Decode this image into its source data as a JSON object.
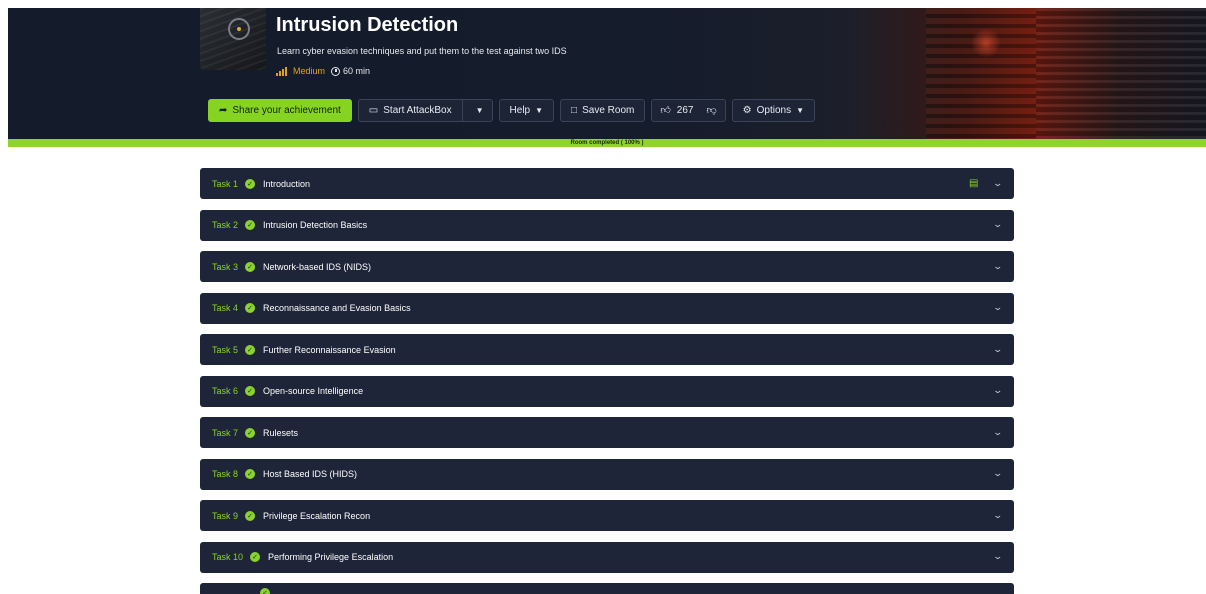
{
  "room": {
    "title": "Intrusion Detection",
    "description": "Learn cyber evasion techniques and put them to the test against two IDS",
    "difficulty": "Medium",
    "duration": "60 min",
    "difficulty_color": "#e0a21a"
  },
  "toolbar": {
    "share_label": "Share your achievement",
    "attackbox_label": "Start AttackBox",
    "help_label": "Help",
    "save_label": "Save Room",
    "likes": "267",
    "options_label": "Options"
  },
  "progress": {
    "label": "Room completed ( 100% )",
    "percent": 100,
    "color": "#8fd42b"
  },
  "tasks": [
    {
      "number": "Task 1",
      "title": "Introduction"
    },
    {
      "number": "Task 2",
      "title": "Intrusion Detection Basics"
    },
    {
      "number": "Task 3",
      "title": "Network-based IDS (NIDS)"
    },
    {
      "number": "Task 4",
      "title": "Reconnaissance and Evasion Basics"
    },
    {
      "number": "Task 5",
      "title": "Further Reconnaissance Evasion"
    },
    {
      "number": "Task 6",
      "title": "Open-source Intelligence"
    },
    {
      "number": "Task 7",
      "title": "Rulesets"
    },
    {
      "number": "Task 8",
      "title": "Host Based IDS (HIDS)"
    },
    {
      "number": "Task 9",
      "title": "Privilege Escalation Recon"
    },
    {
      "number": "Task 10",
      "title": "Performing Privilege Escalation"
    }
  ],
  "icons": {
    "share": "share-arrow-icon",
    "attackbox": "monitor-icon",
    "save": "bookmark-icon",
    "like": "thumbs-up-icon",
    "dislike": "thumbs-down-icon",
    "options": "gear-icon",
    "task_done": "check-circle-icon",
    "task_expand": "chevron-down-icon",
    "server": "server-icon"
  },
  "colors": {
    "accent": "#86d321",
    "task_bg": "#1e2539",
    "hero_bg": "#151c2c"
  }
}
